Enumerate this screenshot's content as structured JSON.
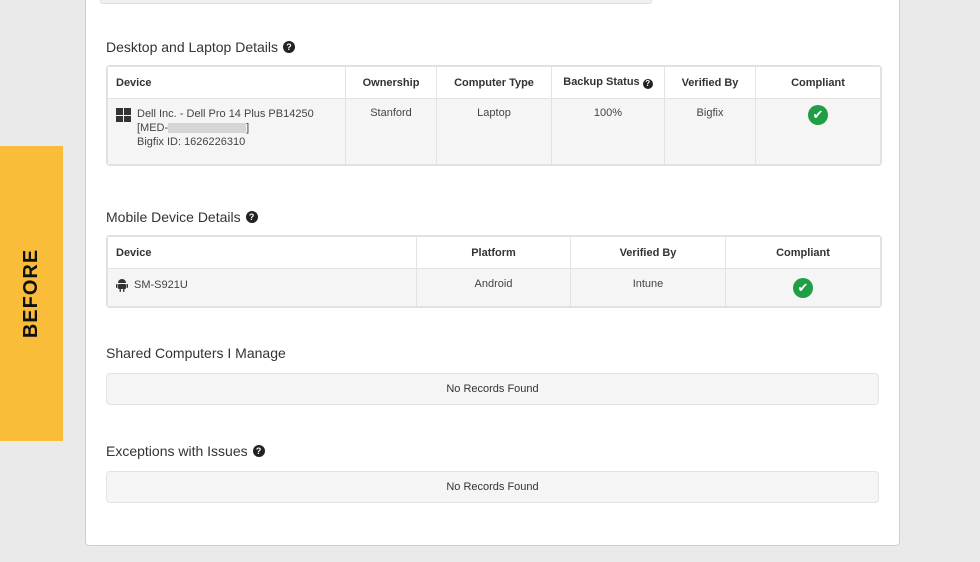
{
  "badge": {
    "label": "BEFORE"
  },
  "desktop": {
    "title": "Desktop and Laptop Details",
    "headers": [
      "Device",
      "Ownership",
      "Computer Type",
      "Backup Status",
      "Verified By",
      "Compliant"
    ],
    "row": {
      "device_line1": "Dell Inc. - Dell Pro 14 Plus PB14250",
      "device_line2_prefix": "[MED-",
      "device_line2_suffix": "]",
      "device_line3": "Bigfix ID: 1626226310",
      "ownership": "Stanford",
      "computer_type": "Laptop",
      "backup_status": "100%",
      "verified_by": "Bigfix",
      "compliant": "✔"
    }
  },
  "mobile": {
    "title": "Mobile Device Details",
    "headers": [
      "Device",
      "Platform",
      "Verified By",
      "Compliant"
    ],
    "row": {
      "device": "SM-S921U",
      "platform": "Android",
      "verified_by": "Intune",
      "compliant": "✔"
    }
  },
  "shared": {
    "title": "Shared Computers I Manage",
    "empty": "No Records Found"
  },
  "exceptions": {
    "title": "Exceptions with Issues",
    "empty": "No Records Found"
  },
  "icons": {
    "help": "?",
    "check_color": "#1f9e46",
    "badge_color": "#f9bd3a"
  }
}
